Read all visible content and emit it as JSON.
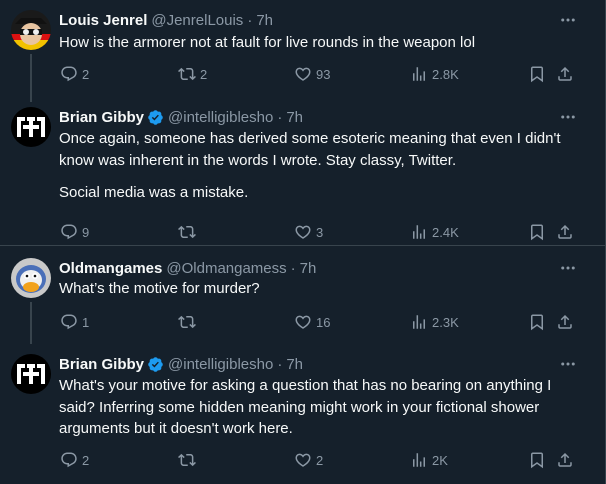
{
  "tweets": [
    {
      "name": "Louis Jenrel",
      "handle": "@JenrelLouis",
      "time": "7h",
      "verified": false,
      "text": [
        "How is the armorer not at fault for live rounds in the weapon lol"
      ],
      "replies": "2",
      "retweets": "2",
      "likes": "93",
      "views": "2.8K"
    },
    {
      "name": "Brian Gibby",
      "handle": "@intelligiblesho",
      "time": "7h",
      "verified": true,
      "text": [
        "Once again, someone has derived some esoteric meaning that even I didn't know was inherent in the words I wrote. Stay classy, Twitter.",
        "Social media was a mistake."
      ],
      "replies": "9",
      "retweets": "",
      "likes": "3",
      "views": "2.4K"
    },
    {
      "name": "Oldmangames",
      "handle": "@Oldmangamess",
      "time": "7h",
      "verified": false,
      "text": [
        "What’s the motive for murder?"
      ],
      "replies": "1",
      "retweets": "",
      "likes": "16",
      "views": "2.3K"
    },
    {
      "name": "Brian Gibby",
      "handle": "@intelligiblesho",
      "time": "7h",
      "verified": true,
      "text": [
        "What's your motive for asking a question that has no bearing on anything I said? Inferring some hidden meaning might work in your fictional shower arguments but it doesn't work here."
      ],
      "replies": "2",
      "retweets": "",
      "likes": "2",
      "views": "2K"
    }
  ],
  "separator": "·",
  "colors": {
    "background": "#15202b",
    "text": "#f7f9f9",
    "secondary": "#8b98a5",
    "verified": "#1d9bf0",
    "border": "#38444d"
  }
}
